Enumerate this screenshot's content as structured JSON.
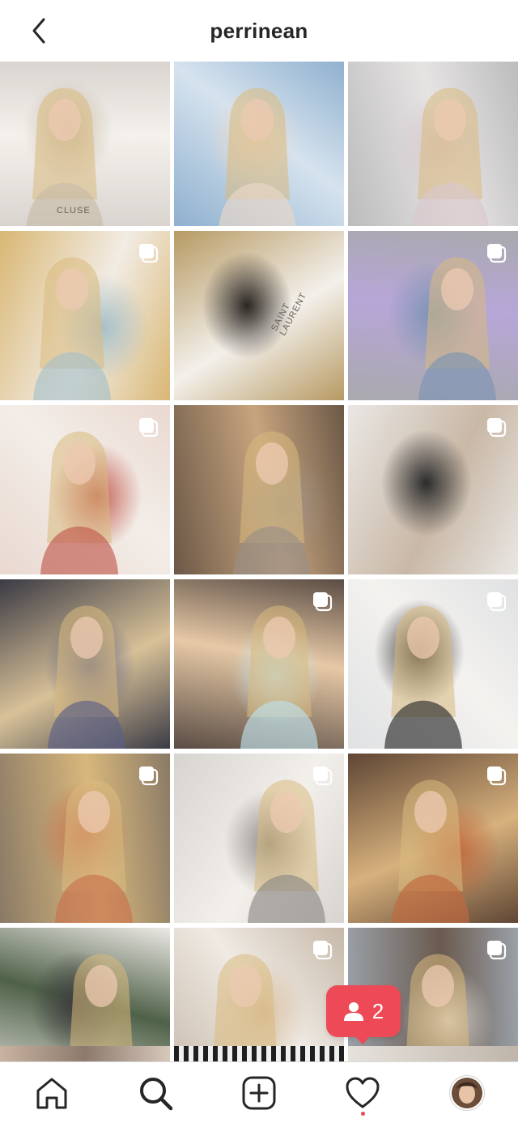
{
  "header": {
    "username": "perrinean",
    "back_icon": "chevron-left-icon"
  },
  "grid": {
    "posts": [
      {
        "id": "post-1",
        "multi": false,
        "palette": [
          "#d9d4cf",
          "#f4f1ec",
          "#c8bca8"
        ],
        "caption_mark": "CLUSE"
      },
      {
        "id": "post-2",
        "multi": false,
        "palette": [
          "#8fb0cf",
          "#d6e3ee",
          "#e9d7c8"
        ]
      },
      {
        "id": "post-3",
        "multi": false,
        "palette": [
          "#bcbcbc",
          "#e6e3e3",
          "#d8c8cc"
        ]
      },
      {
        "id": "post-4",
        "multi": true,
        "palette": [
          "#d9b774",
          "#f2ece4",
          "#a8c0c8"
        ]
      },
      {
        "id": "post-5",
        "multi": false,
        "palette": [
          "#b79a63",
          "#f3f0eb",
          "#2a2622"
        ],
        "caption_mark": "SAINT LAURENT"
      },
      {
        "id": "post-6",
        "multi": true,
        "palette": [
          "#a9a9ad",
          "#b7a6d8",
          "#7c93b4"
        ]
      },
      {
        "id": "post-7",
        "multi": true,
        "palette": [
          "#e9d9d0",
          "#f3ede8",
          "#c25a4e"
        ]
      },
      {
        "id": "post-8",
        "multi": false,
        "palette": [
          "#6b5847",
          "#c7a47e",
          "#9a8f86"
        ]
      },
      {
        "id": "post-9",
        "multi": true,
        "palette": [
          "#e9e7e4",
          "#c9b8a6",
          "#2c2c2c"
        ]
      },
      {
        "id": "post-10",
        "multi": false,
        "palette": [
          "#3b3b45",
          "#d8c198",
          "#5b5f86"
        ]
      },
      {
        "id": "post-11",
        "multi": true,
        "palette": [
          "#5a4c44",
          "#e7c9a6",
          "#bfe1ea"
        ]
      },
      {
        "id": "post-12",
        "multi": true,
        "palette": [
          "#dfe1e3",
          "#f4f2ef",
          "#2b2b2b"
        ]
      },
      {
        "id": "post-13",
        "multi": true,
        "palette": [
          "#8a7a66",
          "#d8b77c",
          "#c9714d"
        ]
      },
      {
        "id": "post-14",
        "multi": true,
        "palette": [
          "#d7d3cf",
          "#f3efea",
          "#8d8a86"
        ]
      },
      {
        "id": "post-15",
        "multi": true,
        "palette": [
          "#5f4634",
          "#d7b17d",
          "#c0683e"
        ]
      },
      {
        "id": "post-16",
        "multi": false,
        "palette": [
          "#ece9e5",
          "#4f6148",
          "#3c3c3c"
        ]
      },
      {
        "id": "post-17",
        "multi": true,
        "palette": [
          "#c6b8a8",
          "#efeae3",
          "#d8bfa0"
        ]
      },
      {
        "id": "post-18",
        "multi": true,
        "palette": [
          "#9aa1a8",
          "#6a5a4f",
          "#d9d3cc"
        ]
      }
    ]
  },
  "notification": {
    "icon": "person-icon",
    "count": "2",
    "color": "#ed4956"
  },
  "bottom_nav": {
    "items": [
      {
        "name": "home",
        "icon": "home-icon"
      },
      {
        "name": "search",
        "icon": "search-icon",
        "active": true
      },
      {
        "name": "new-post",
        "icon": "plus-square-icon"
      },
      {
        "name": "activity",
        "icon": "heart-icon",
        "has_dot": true
      },
      {
        "name": "profile",
        "icon": "avatar-icon"
      }
    ]
  },
  "colors": {
    "accent": "#ed4956",
    "text": "#262626",
    "divider": "#dbdbdb"
  }
}
